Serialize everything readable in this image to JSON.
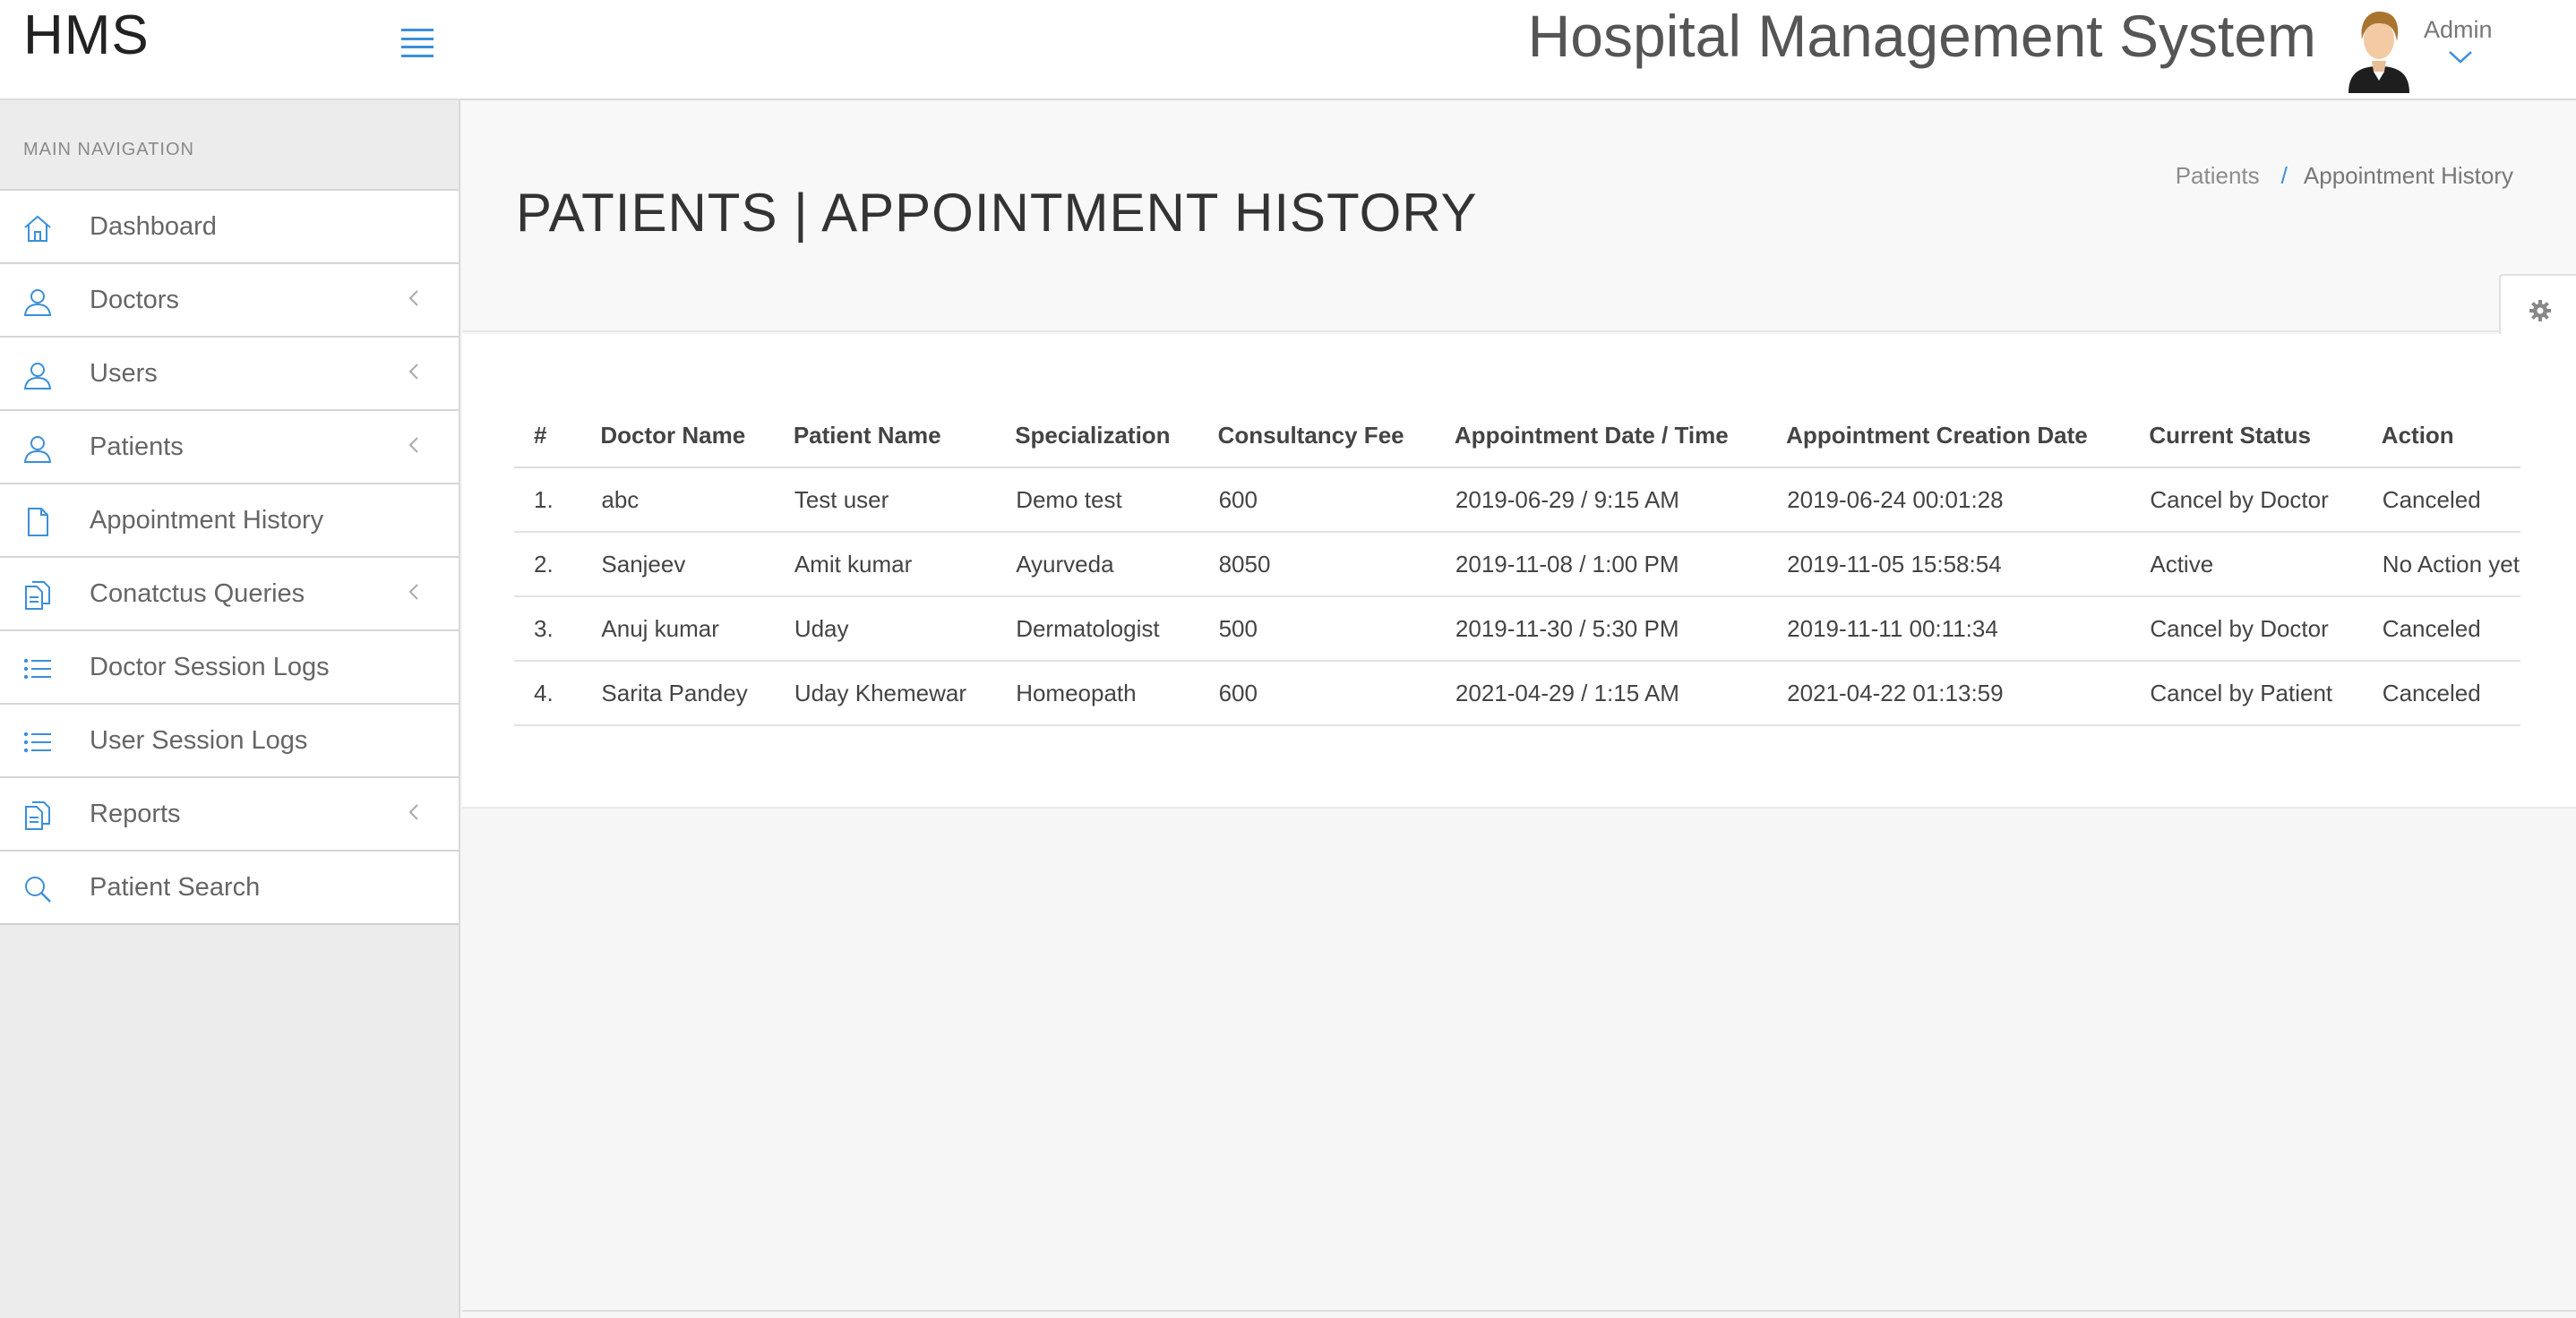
{
  "brand": {
    "title": "HMS"
  },
  "sidebar": {
    "caption": "MAIN NAVIGATION",
    "items": [
      {
        "label": "Dashboard",
        "icon": "home-icon",
        "chevron": false
      },
      {
        "label": "Doctors",
        "icon": "user-icon",
        "chevron": true
      },
      {
        "label": "Users",
        "icon": "user-icon",
        "chevron": true
      },
      {
        "label": "Patients",
        "icon": "user-icon",
        "chevron": true
      },
      {
        "label": "Appointment History",
        "icon": "file-icon",
        "chevron": false
      },
      {
        "label": "Conatctus Queries",
        "icon": "files-icon",
        "chevron": true
      },
      {
        "label": "Doctor Session Logs",
        "icon": "list-icon",
        "chevron": false
      },
      {
        "label": "User Session Logs",
        "icon": "list-icon",
        "chevron": false
      },
      {
        "label": "Reports",
        "icon": "files-icon",
        "chevron": true
      },
      {
        "label": "Patient Search",
        "icon": "search-icon",
        "chevron": false
      }
    ]
  },
  "header": {
    "app_title": "Hospital Management System",
    "user": "Admin"
  },
  "page": {
    "title": "PATIENTS | APPOINTMENT HISTORY",
    "breadcrumb": {
      "parent": "Patients",
      "separator": "/",
      "current": "Appointment History"
    }
  },
  "table": {
    "columns": [
      "#",
      "Doctor Name",
      "Patient Name",
      "Specialization",
      "Consultancy Fee",
      "Appointment Date / Time",
      "Appointment Creation Date",
      "Current Status",
      "Action"
    ],
    "rows": [
      [
        "1.",
        "abc",
        "Test user",
        "Demo test",
        "600",
        "2019-06-29 / 9:15 AM",
        "2019-06-24 00:01:28",
        "Cancel by Doctor",
        "Canceled"
      ],
      [
        "2.",
        "Sanjeev",
        "Amit kumar",
        "Ayurveda",
        "8050",
        "2019-11-08 / 1:00 PM",
        "2019-11-05 15:58:54",
        "Active",
        "No Action yet"
      ],
      [
        "3.",
        "Anuj kumar",
        "Uday",
        "Dermatologist",
        "500",
        "2019-11-30 / 5:30 PM",
        "2019-11-11 00:11:34",
        "Cancel by Doctor",
        "Canceled"
      ],
      [
        "4.",
        "Sarita Pandey",
        "Uday Khemewar",
        "Homeopath",
        "600",
        "2021-04-29 / 1:15 AM",
        "2021-04-22 01:13:59",
        "Cancel by Patient",
        "Canceled"
      ]
    ]
  },
  "colors": {
    "accent": "#3b8fd9",
    "sidebar_bg": "#ececed",
    "content_bg": "#f6f6f6"
  }
}
